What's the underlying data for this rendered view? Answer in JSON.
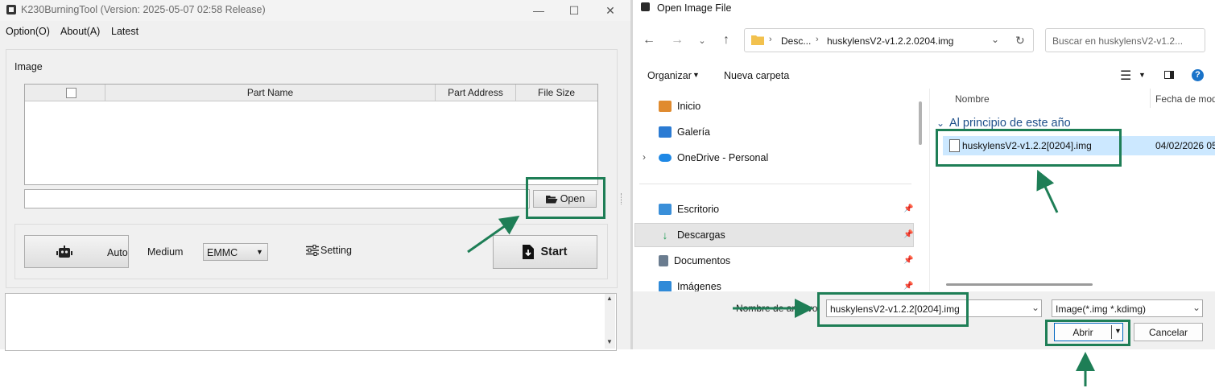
{
  "left_window": {
    "title": "K230BurningTool (Version: 2025-05-07 02:58 Release)",
    "controls": {
      "minimize": "—",
      "maximize": "☐",
      "close": "✕"
    },
    "menu": [
      "Option(O)",
      "About(A)",
      "Latest"
    ],
    "image_group_label": "Image",
    "table": {
      "columns": [
        "Part Name",
        "Part Address",
        "File Size"
      ],
      "rows": []
    },
    "path_value": "",
    "open_label": "Open",
    "auto_label": "Auto",
    "medium_label": "Medium",
    "medium_value": "EMMC",
    "setting_label": "Setting",
    "start_label": "Start"
  },
  "dialog": {
    "title": "Open Image File",
    "breadcrumb": [
      "Desc...",
      "huskylensV2-v1.2.2.0204.img"
    ],
    "search_placeholder": "Buscar en huskylensV2-v1.2...",
    "organize_label": "Organizar",
    "new_folder_label": "Nueva carpeta",
    "sidebar": [
      {
        "label": "Inicio",
        "icon": "home-icon",
        "color": "#e08b2f",
        "pinned": false
      },
      {
        "label": "Galería",
        "icon": "gallery-icon",
        "color": "#2b7bd3",
        "pinned": false
      },
      {
        "label": "OneDrive - Personal",
        "icon": "cloud-icon",
        "color": "#1e88e5",
        "pinned": false,
        "expander": "›"
      },
      {
        "label": "Escritorio",
        "icon": "desktop-icon",
        "color": "#3a8fd9",
        "pinned": true
      },
      {
        "label": "Descargas",
        "icon": "download-icon",
        "color": "#1f9d55",
        "pinned": true,
        "selected": true
      },
      {
        "label": "Documentos",
        "icon": "documents-icon",
        "color": "#6a7c8f",
        "pinned": true
      },
      {
        "label": "Imágenes",
        "icon": "pictures-icon",
        "color": "#2f8ad8",
        "pinned": true
      }
    ],
    "columns": [
      "Nombre",
      "Fecha de mod"
    ],
    "group_header": "Al principio de este año",
    "files": [
      {
        "name": "huskylensV2-v1.2.2[0204].img",
        "date": "04/02/2026 05:"
      }
    ],
    "filename_label": "Nombre de archivo:",
    "filename_value": "huskylensV2-v1.2.2[0204].img",
    "filter_value": "Image(*.img *.kdimg)",
    "open_button": "Abrir",
    "cancel_button": "Cancelar"
  },
  "colors": {
    "highlight": "#1e7e56",
    "selection": "#cce8ff"
  }
}
